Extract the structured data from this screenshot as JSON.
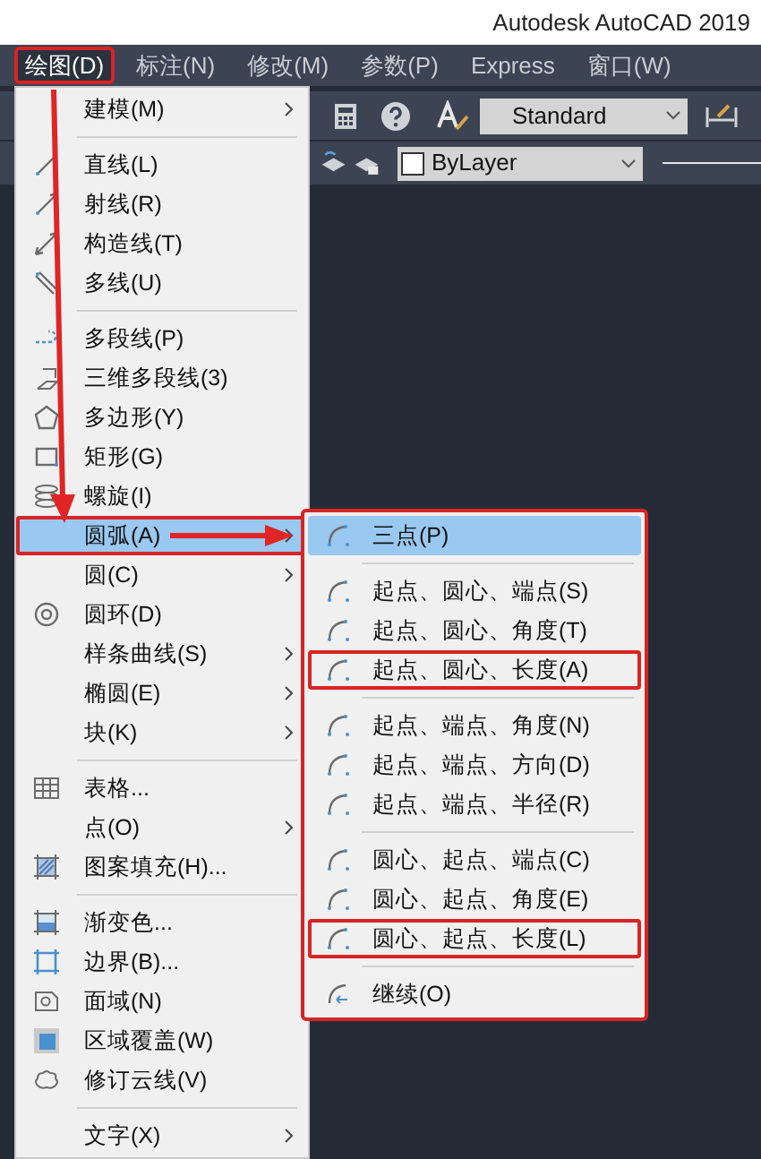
{
  "window": {
    "title": "Autodesk AutoCAD 2019"
  },
  "menubar": [
    {
      "label": "绘图(D)",
      "selected": true,
      "marked": true
    },
    {
      "label": "标注(N)",
      "selected": false,
      "marked": false
    },
    {
      "label": "修改(M)",
      "selected": false,
      "marked": false
    },
    {
      "label": "参数(P)",
      "selected": false,
      "marked": false
    },
    {
      "label": "Express",
      "selected": false,
      "marked": false
    },
    {
      "label": "窗口(W)",
      "selected": false,
      "marked": false
    }
  ],
  "toolbar": {
    "text_style": "Standard",
    "color_control": "ByLayer"
  },
  "draw_menu": {
    "items": [
      {
        "kind": "item",
        "label": "建模(M)",
        "has_submenu": true,
        "selected": false,
        "marked": false
      },
      {
        "kind": "separator"
      },
      {
        "kind": "item",
        "label": "直线(L)",
        "has_submenu": false,
        "selected": false,
        "marked": false
      },
      {
        "kind": "item",
        "label": "射线(R)",
        "has_submenu": false,
        "selected": false,
        "marked": false
      },
      {
        "kind": "item",
        "label": "构造线(T)",
        "has_submenu": false,
        "selected": false,
        "marked": false
      },
      {
        "kind": "item",
        "label": "多线(U)",
        "has_submenu": false,
        "selected": false,
        "marked": false
      },
      {
        "kind": "separator"
      },
      {
        "kind": "item",
        "label": "多段线(P)",
        "has_submenu": false,
        "selected": false,
        "marked": false
      },
      {
        "kind": "item",
        "label": "三维多段线(3)",
        "has_submenu": false,
        "selected": false,
        "marked": false
      },
      {
        "kind": "item",
        "label": "多边形(Y)",
        "has_submenu": false,
        "selected": false,
        "marked": false
      },
      {
        "kind": "item",
        "label": "矩形(G)",
        "has_submenu": false,
        "selected": false,
        "marked": false
      },
      {
        "kind": "item",
        "label": "螺旋(I)",
        "has_submenu": false,
        "selected": false,
        "marked": false
      },
      {
        "kind": "item",
        "label": "圆弧(A)",
        "has_submenu": true,
        "selected": true,
        "marked": true
      },
      {
        "kind": "item",
        "label": "圆(C)",
        "has_submenu": true,
        "selected": false,
        "marked": false
      },
      {
        "kind": "item",
        "label": "圆环(D)",
        "has_submenu": false,
        "selected": false,
        "marked": false
      },
      {
        "kind": "item",
        "label": "样条曲线(S)",
        "has_submenu": true,
        "selected": false,
        "marked": false
      },
      {
        "kind": "item",
        "label": "椭圆(E)",
        "has_submenu": true,
        "selected": false,
        "marked": false
      },
      {
        "kind": "item",
        "label": "块(K)",
        "has_submenu": true,
        "selected": false,
        "marked": false
      },
      {
        "kind": "separator"
      },
      {
        "kind": "item",
        "label": "表格...",
        "has_submenu": false,
        "selected": false,
        "marked": false
      },
      {
        "kind": "item",
        "label": "点(O)",
        "has_submenu": true,
        "selected": false,
        "marked": false
      },
      {
        "kind": "item",
        "label": "图案填充(H)...",
        "has_submenu": false,
        "selected": false,
        "marked": false
      },
      {
        "kind": "separator"
      },
      {
        "kind": "item",
        "label": "渐变色...",
        "has_submenu": false,
        "selected": false,
        "marked": false
      },
      {
        "kind": "item",
        "label": "边界(B)...",
        "has_submenu": false,
        "selected": false,
        "marked": false
      },
      {
        "kind": "item",
        "label": "面域(N)",
        "has_submenu": false,
        "selected": false,
        "marked": false
      },
      {
        "kind": "item",
        "label": "区域覆盖(W)",
        "has_submenu": false,
        "selected": false,
        "marked": false
      },
      {
        "kind": "item",
        "label": "修订云线(V)",
        "has_submenu": false,
        "selected": false,
        "marked": false
      },
      {
        "kind": "separator"
      },
      {
        "kind": "item",
        "label": "文字(X)",
        "has_submenu": true,
        "selected": false,
        "marked": false
      }
    ]
  },
  "arc_submenu": {
    "marked": true,
    "items": [
      {
        "kind": "item",
        "label": "三点(P)",
        "selected": true,
        "marked": false
      },
      {
        "kind": "separator"
      },
      {
        "kind": "item",
        "label": "起点、圆心、端点(S)",
        "selected": false,
        "marked": false
      },
      {
        "kind": "item",
        "label": "起点、圆心、角度(T)",
        "selected": false,
        "marked": false
      },
      {
        "kind": "item",
        "label": "起点、圆心、长度(A)",
        "selected": false,
        "marked": true
      },
      {
        "kind": "separator"
      },
      {
        "kind": "item",
        "label": "起点、端点、角度(N)",
        "selected": false,
        "marked": false
      },
      {
        "kind": "item",
        "label": "起点、端点、方向(D)",
        "selected": false,
        "marked": false
      },
      {
        "kind": "item",
        "label": "起点、端点、半径(R)",
        "selected": false,
        "marked": false
      },
      {
        "kind": "separator"
      },
      {
        "kind": "item",
        "label": "圆心、起点、端点(C)",
        "selected": false,
        "marked": false
      },
      {
        "kind": "item",
        "label": "圆心、起点、角度(E)",
        "selected": false,
        "marked": false
      },
      {
        "kind": "item",
        "label": "圆心、起点、长度(L)",
        "selected": false,
        "marked": true
      },
      {
        "kind": "separator"
      },
      {
        "kind": "item",
        "label": "继续(O)",
        "selected": false,
        "marked": false
      }
    ]
  }
}
